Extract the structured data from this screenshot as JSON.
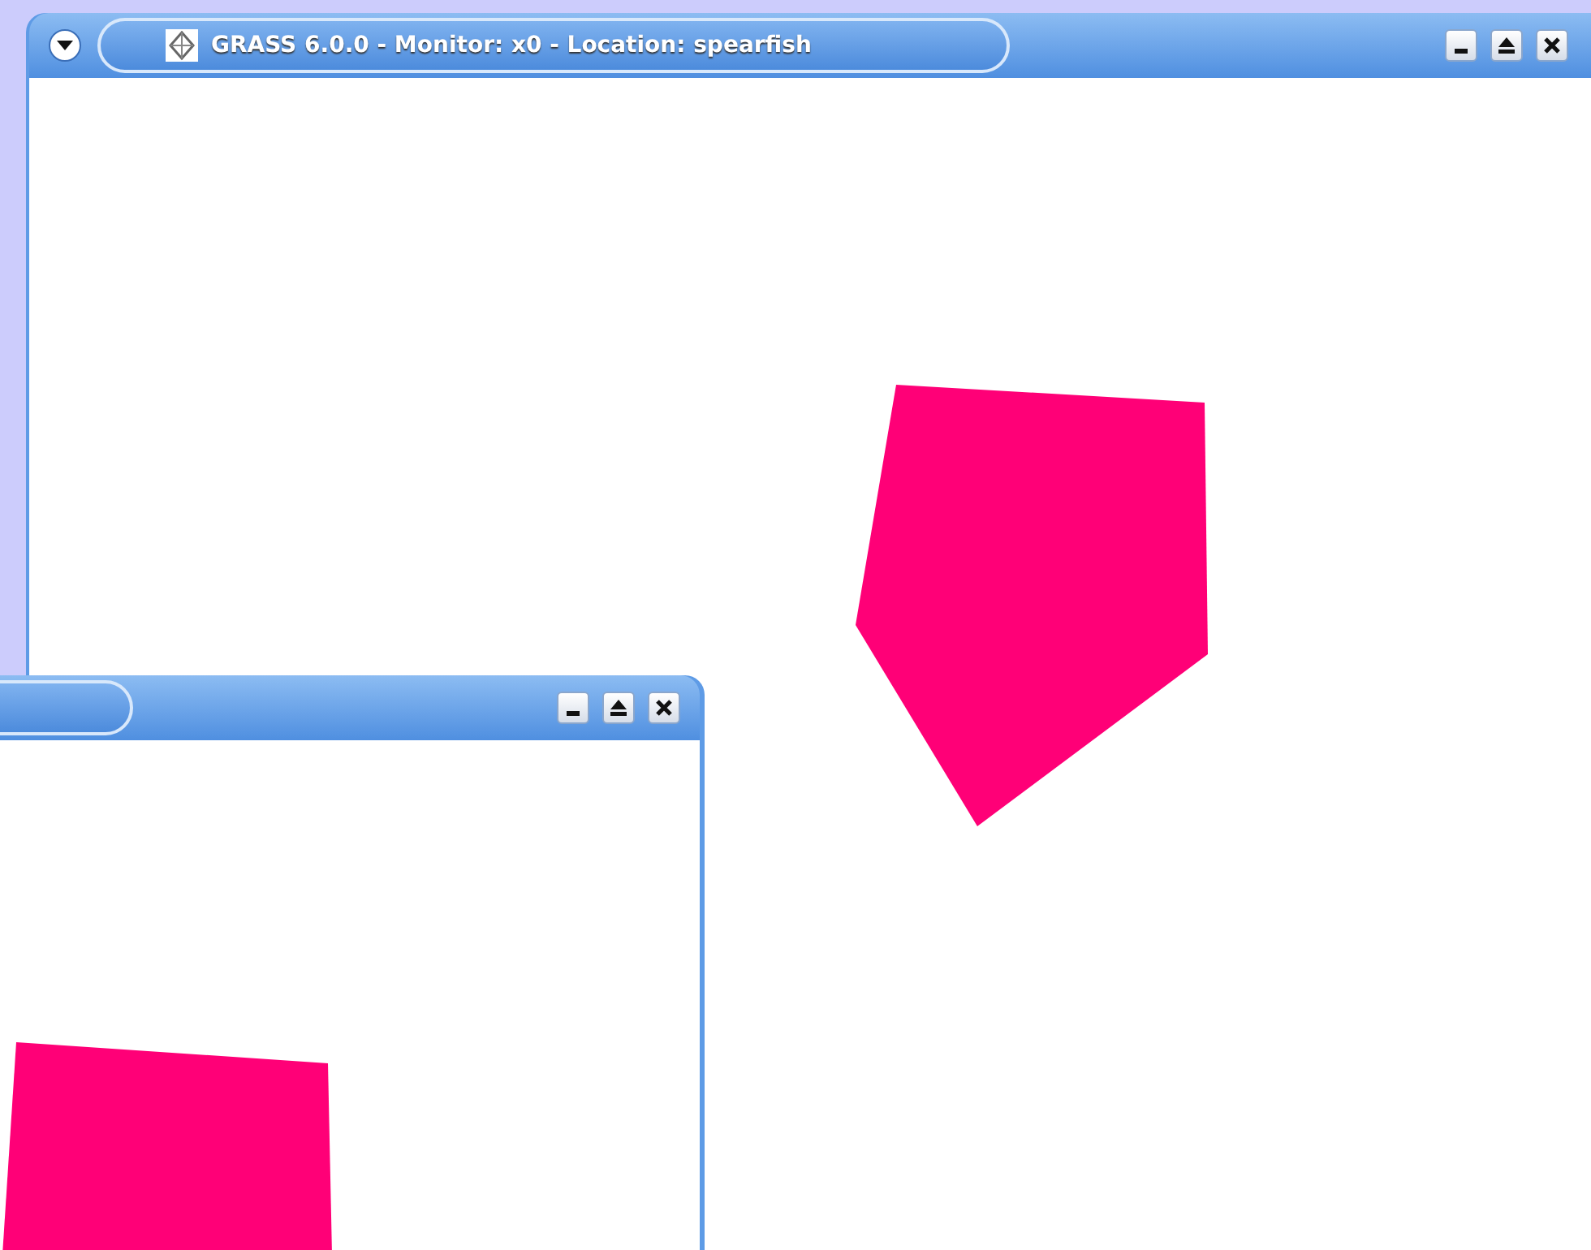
{
  "monitor_window": {
    "title": "GRASS 6.0.0 - Monitor: x0 - Location: spearfish"
  }
}
